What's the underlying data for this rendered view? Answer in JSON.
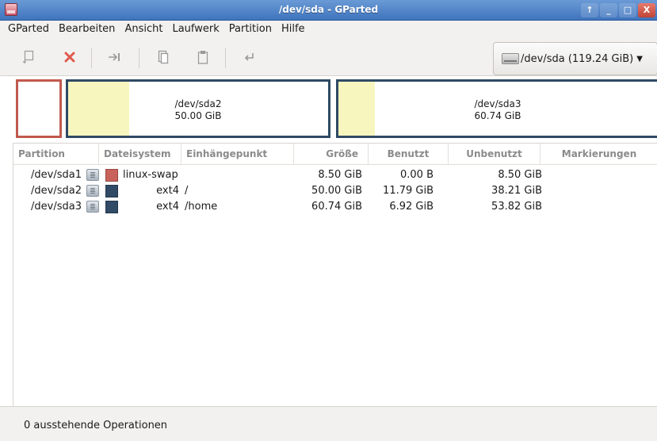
{
  "window": {
    "title": "/dev/sda - GParted",
    "controls": [
      "↑",
      "_",
      "□",
      "X"
    ]
  },
  "menubar": {
    "items": [
      "GParted",
      "Bearbeiten",
      "Ansicht",
      "Laufwerk",
      "Partition",
      "Hilfe"
    ]
  },
  "toolbar": {
    "buttons": [
      {
        "name": "new-partition",
        "icon": "new-partition-icon",
        "glyph": "⊡"
      },
      {
        "name": "delete-partition",
        "icon": "delete-icon",
        "glyph": "✖"
      },
      {
        "name": "resize-move",
        "icon": "resize-move-icon",
        "glyph": "⇥"
      },
      {
        "name": "copy",
        "icon": "copy-icon",
        "glyph": "❐"
      },
      {
        "name": "paste",
        "icon": "paste-icon",
        "glyph": "📋"
      },
      {
        "name": "undo",
        "icon": "undo-icon",
        "glyph": "↵"
      }
    ],
    "device": "/dev/sda (119.24 GiB)"
  },
  "diskmap": {
    "partitions": [
      {
        "name": "/dev/sda1",
        "label": "",
        "size": "",
        "border": "#c0594d"
      },
      {
        "name": "/dev/sda2",
        "label": "/dev/sda2",
        "size": "50.00 GiB",
        "border": "#2f4a64",
        "used_fraction": 0.236
      },
      {
        "name": "/dev/sda3",
        "label": "/dev/sda3",
        "size": "60.74 GiB",
        "border": "#2f4a64",
        "used_fraction": 0.114
      }
    ]
  },
  "table": {
    "headers": [
      "Partition",
      "Dateisystem",
      "Einhängepunkt",
      "Größe",
      "Benutzt",
      "Unbenutzt",
      "Markierungen"
    ],
    "rows": [
      {
        "partition": "/dev/sda1",
        "fs": "linux-swap",
        "fs_color": "#c9625a",
        "mount": "",
        "size": "8.50 GiB",
        "used": "0.00 B",
        "unused": "8.50 GiB",
        "flags": ""
      },
      {
        "partition": "/dev/sda2",
        "fs": "ext4",
        "fs_color": "#314a66",
        "mount": "/",
        "size": "50.00 GiB",
        "used": "11.79 GiB",
        "unused": "38.21 GiB",
        "flags": ""
      },
      {
        "partition": "/dev/sda3",
        "fs": "ext4",
        "fs_color": "#314a66",
        "mount": "/home",
        "size": "60.74 GiB",
        "used": "6.92 GiB",
        "unused": "53.82 GiB",
        "flags": ""
      }
    ]
  },
  "statusbar": {
    "text": "0 ausstehende Operationen"
  }
}
